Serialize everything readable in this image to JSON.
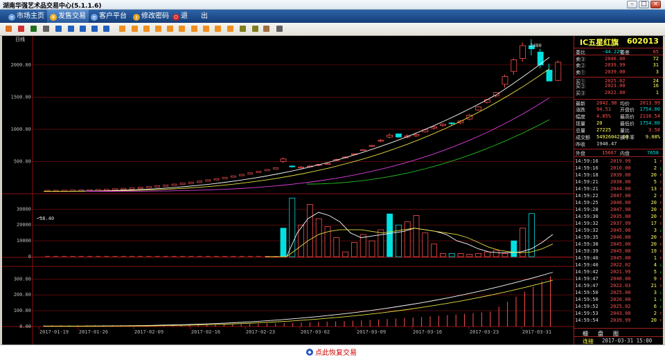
{
  "window": {
    "title": "湖南华强艺术品交易中心(5.1.1.6)",
    "controls": [
      "minimize",
      "maximize",
      "close"
    ]
  },
  "menu": [
    {
      "label": "市场主页",
      "icon": "home-icon",
      "active": false
    },
    {
      "label": "发售交易",
      "icon": "trade-icon",
      "active": true
    },
    {
      "label": "客户平台",
      "icon": "client-icon",
      "active": false
    },
    {
      "label": "修改密码",
      "icon": "key-icon",
      "active": false
    },
    {
      "label": "退",
      "icon": "exit-icon",
      "active": false
    },
    {
      "label": "出",
      "icon": "",
      "active": false
    }
  ],
  "toolbar": {
    "icons": [
      "bar-chart-icon",
      "trend-icon",
      "candlestick-icon",
      "table-icon",
      "layout-icon",
      "tool-icon",
      "tool-icon",
      "tool-icon",
      "close-icon",
      "F1-icon",
      "F2-icon",
      "F3-icon",
      "F4-icon",
      "F5-icon",
      "F6-icon",
      "F7-icon",
      "F8-icon",
      "F9-icon",
      "F10-icon",
      "zoom-in-icon",
      "zoom-out-icon",
      "draw-icon",
      "settings-icon"
    ]
  },
  "chart": {
    "period_label": "日线",
    "price_ticks": [
      "2000.00",
      "1500.00",
      "1000.00",
      "500.00"
    ],
    "volume_ticks": [
      "30000",
      "20000",
      "10000",
      "0"
    ],
    "amount_ticks": [
      "300.00",
      "200.00",
      "100.00",
      "0.00"
    ],
    "date_ticks": [
      "2017-01-19",
      "2017-01-26",
      "2017-02-09",
      "2017-02-16",
      "2017-02-23",
      "2017-03-02",
      "2017-03-09",
      "2017-03-16",
      "2017-03-23",
      "2017-03-31"
    ],
    "start_price_label": "38.40",
    "high_label": "2400"
  },
  "chart_data": {
    "type": "candlestick",
    "price_ylim": [
      0,
      2450
    ],
    "candles_from_2017_02_23": [
      [
        500,
        560,
        480,
        540
      ],
      [
        430,
        440,
        405,
        420
      ],
      [
        400,
        430,
        395,
        415
      ],
      [
        420,
        440,
        410,
        430
      ],
      [
        440,
        460,
        430,
        455
      ],
      [
        470,
        480,
        455,
        470
      ],
      [
        520,
        540,
        510,
        530
      ],
      [
        560,
        580,
        550,
        570
      ],
      [
        620,
        630,
        605,
        620
      ],
      [
        680,
        690,
        670,
        685
      ],
      [
        740,
        760,
        730,
        750
      ],
      [
        820,
        850,
        800,
        830
      ],
      [
        880,
        940,
        860,
        910
      ],
      [
        930,
        920,
        870,
        880
      ],
      [
        880,
        920,
        860,
        900
      ],
      [
        900,
        940,
        880,
        920
      ],
      [
        960,
        1000,
        950,
        990
      ],
      [
        1020,
        1060,
        1000,
        1040
      ],
      [
        1060,
        1090,
        1040,
        1080
      ],
      [
        1100,
        1110,
        1060,
        1090
      ],
      [
        1100,
        1140,
        1080,
        1130
      ],
      [
        1160,
        1240,
        1140,
        1220
      ],
      [
        1300,
        1360,
        1290,
        1350
      ],
      [
        1420,
        1470,
        1400,
        1460
      ],
      [
        1520,
        1580,
        1500,
        1570
      ],
      [
        1700,
        1850,
        1650,
        1820
      ],
      [
        1900,
        2100,
        1850,
        2080
      ],
      [
        2100,
        2350,
        2050,
        2300
      ],
      [
        2300,
        2400,
        2150,
        2250
      ],
      [
        2200,
        2250,
        1950,
        2000
      ],
      [
        1920,
        2020,
        1750,
        1750
      ],
      [
        1760,
        2070,
        1750,
        2042
      ]
    ],
    "volume_ylim": [
      0,
      38000
    ],
    "volume": [
      18000,
      37000,
      20000,
      33000,
      24000,
      19000,
      12000,
      3000,
      9000,
      14000,
      10000,
      17000,
      27000,
      20000,
      22000,
      26000,
      15000,
      8000,
      2000,
      2000,
      2000,
      1500,
      2000,
      3000,
      4000,
      2000,
      10000,
      18000,
      27225
    ],
    "amount_ylim": [
      0,
      380
    ],
    "quote": {
      "last": 2042.98,
      "open": 2013.99,
      "prev_close": 1948.47,
      "high": 2116.54,
      "low": 1754.0
    }
  },
  "board": {
    "name": "IC五星红旗",
    "code": "602013",
    "ratio": {
      "label": "委比",
      "value": "-44.22%",
      "label2": "委差",
      "value2": "65"
    },
    "asks": [
      {
        "label": "卖③",
        "price": "2040.00",
        "vol": "72"
      },
      {
        "label": "卖②",
        "price": "2039.99",
        "vol": "31"
      },
      {
        "label": "卖①",
        "price": "2039.00",
        "vol": "3"
      }
    ],
    "bids": [
      {
        "label": "买①",
        "price": "2025.02",
        "vol": "24"
      },
      {
        "label": "买②",
        "price": "2023.00",
        "vol": "16"
      },
      {
        "label": "买③",
        "price": "2022.00",
        "vol": "1"
      }
    ],
    "stats": [
      {
        "l1": "最新",
        "v1": "2042.98",
        "l2": "均价",
        "v2": "2013.99"
      },
      {
        "l1": "涨跌",
        "v1": "94.51",
        "l2": "开盘价",
        "v2": "1754.00"
      },
      {
        "l1": "幅度",
        "v1": "4.85%",
        "l2": "最高价",
        "v2": "2116.54"
      },
      {
        "l1": "现量",
        "v1": "20",
        "l2": "最低价",
        "v2": "1754.00"
      },
      {
        "l1": "总量",
        "v1": "27225",
        "l2": "量比",
        "v2": "3.58"
      },
      {
        "l1": "成交额",
        "v1": "54926042.00",
        "l2": "换手率",
        "v2": "9.08%"
      },
      {
        "l1": "昨收",
        "v1": "1948.47",
        "l2": "",
        "v2": ""
      }
    ],
    "outer": {
      "label": "外盘",
      "value": "15667",
      "label2": "内盘",
      "value2": "7658"
    },
    "ticks": [
      [
        "14:59:16",
        "2019.99",
        "1",
        "up"
      ],
      [
        "14:59:16",
        "2010.00",
        "2",
        "down"
      ],
      [
        "14:59:18",
        "2039.00",
        "20",
        "up"
      ],
      [
        "14:59:21",
        "2038.00",
        "5",
        "up"
      ],
      [
        "14:59:21",
        "2044.00",
        "13",
        "up"
      ],
      [
        "14:59:22",
        "2047.00",
        "2",
        "up"
      ],
      [
        "14:59:25",
        "2040.00",
        "20",
        "up"
      ],
      [
        "14:59:28",
        "2047.90",
        "20",
        "up"
      ],
      [
        "14:59:30",
        "2035.00",
        "20",
        "up"
      ],
      [
        "14:59:32",
        "2037.99",
        "17",
        "up"
      ],
      [
        "14:59:32",
        "2045.00",
        "3",
        "down"
      ],
      [
        "14:59:35",
        "2046.00",
        "20",
        "up"
      ],
      [
        "14:59:38",
        "2045.00",
        "20",
        "up"
      ],
      [
        "14:59:39",
        "2045.00",
        "19",
        "up"
      ],
      [
        "14:59:40",
        "2045.00",
        "1",
        "up"
      ],
      [
        "14:59:40",
        "2022.02",
        "4",
        "down"
      ],
      [
        "14:59:42",
        "2021.99",
        "5",
        "down"
      ],
      [
        "14:59:47",
        "2040.00",
        "9",
        "up"
      ],
      [
        "14:59:47",
        "2022.03",
        "21",
        "up"
      ],
      [
        "14:59:50",
        "2025.00",
        "3",
        "down"
      ],
      [
        "14:59:50",
        "2020.00",
        "1",
        "down"
      ],
      [
        "14:59:52",
        "2025.02",
        "6",
        "down"
      ],
      [
        "14:59:53",
        "2043.00",
        "2",
        "up"
      ],
      [
        "14:59:54",
        "2039.99",
        "20",
        "up"
      ]
    ],
    "tabs": [
      "细",
      "盘",
      "图"
    ],
    "connection": "连接",
    "datetime": "2017-03-31 15:00"
  },
  "status": {
    "restore_label": "点此恢复交易"
  },
  "colors": {
    "up": "#ff5050",
    "down": "#00e0e0",
    "grid": "#8a1010",
    "ma1": "#ffffff",
    "ma2": "#e8e040",
    "ma3": "#e040e0",
    "ma4": "#20c020"
  }
}
